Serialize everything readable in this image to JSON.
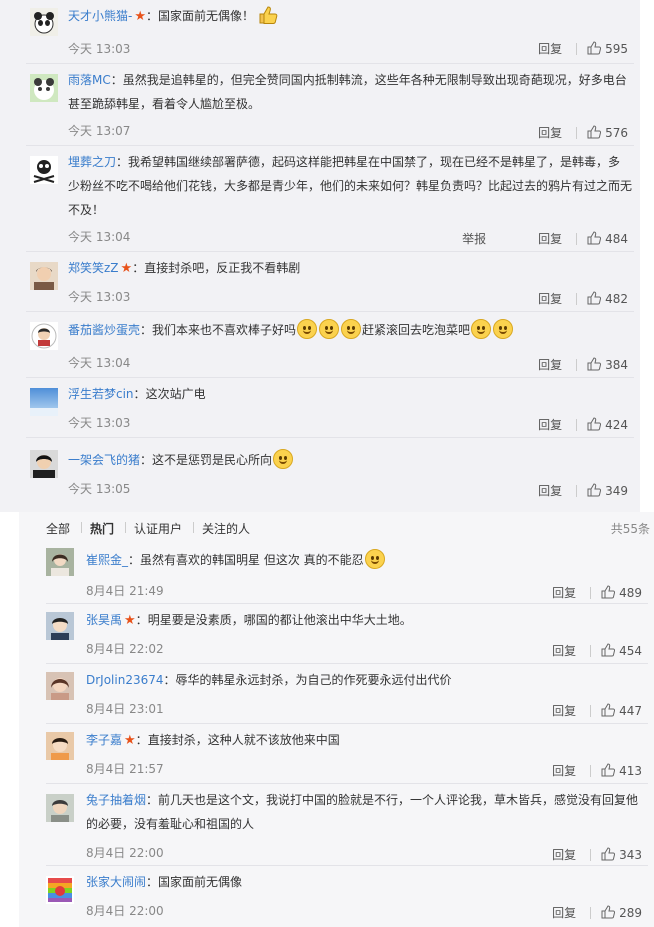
{
  "reply_label": "回复",
  "report_label": "举报",
  "top_comments": [
    {
      "user": "天才小熊猫-",
      "vip": true,
      "text": "国家面前无偶像！",
      "emoji_after": "thumbs-up",
      "time": "今天 13:03",
      "likes": "595"
    },
    {
      "user": "雨落MC",
      "vip": false,
      "text": "虽然我是追韩星的，但完全赞同国内抵制韩流，这些年各种无限制导致出现奇葩现况，好多电台甚至跪舔韩星，看着令人尴尬至极。",
      "time": "今天 13:07",
      "likes": "576"
    },
    {
      "user": "埋葬之刀",
      "vip": false,
      "text": "我希望韩国继续部署萨德，起码这样能把韩星在中国禁了，现在已经不是韩星了，是韩毒，多少粉丝不吃不喝给他们花钱，大多都是青少年，他们的未来如何？韩星负责吗？比起过去的鸦片有过之而无不及！",
      "time": "今天 13:04",
      "likes": "484",
      "has_report": true
    },
    {
      "user": "郑笑笑zZ",
      "vip": true,
      "text": "直接封杀吧，反正我不看韩剧",
      "time": "今天 13:03",
      "likes": "482"
    },
    {
      "user": "番茄酱炒蛋壳",
      "vip": false,
      "text_a": "我们本来也不喜欢棒子好吗",
      "text_b": "赶紧滚回去吃泡菜吧",
      "time": "今天 13:04",
      "likes": "384"
    },
    {
      "user": "浮生若梦cin",
      "vip": false,
      "text": "这次站广电",
      "time": "今天 13:03",
      "likes": "424"
    },
    {
      "user": "一架会飞的猪",
      "vip": false,
      "text": "这不是惩罚是民心所向",
      "time": "今天 13:05",
      "likes": "349"
    }
  ],
  "tabs": {
    "all": "全部",
    "hot": "热门",
    "verified": "认证用户",
    "following": "关注的人",
    "total": "共55条"
  },
  "bottom_comments": [
    {
      "user": "崔熙金_",
      "vip": false,
      "text": "虽然有喜欢的韩国明星 但这次 真的不能忍",
      "time": "8月4日 21:49",
      "likes": "489"
    },
    {
      "user": "张昊禹",
      "vip": true,
      "text": "明星要是没素质，哪国的都让他滚出中华大土地。",
      "time": "8月4日 22:02",
      "likes": "454"
    },
    {
      "user": "DrJolin23674",
      "vip": false,
      "text": "辱华的韩星永远封杀，为自己的作死要永远付出代价",
      "time": "8月4日 23:01",
      "likes": "447"
    },
    {
      "user": "李子嘉",
      "vip": true,
      "text": "直接封杀，这种人就不该放他来中国",
      "time": "8月4日 21:57",
      "likes": "413"
    },
    {
      "user": "兔子抽着烟",
      "vip": false,
      "text": "前几天也是这个文，我说打中国的脸就是不行，一个人评论我，草木皆兵，感觉没有回复他的必要，没有羞耻心和祖国的人",
      "time": "8月4日 22:00",
      "likes": "343"
    },
    {
      "user": "张家大闹闹",
      "vip": false,
      "text": "国家面前无偶像",
      "time": "8月4日 22:00",
      "likes": "289"
    }
  ]
}
